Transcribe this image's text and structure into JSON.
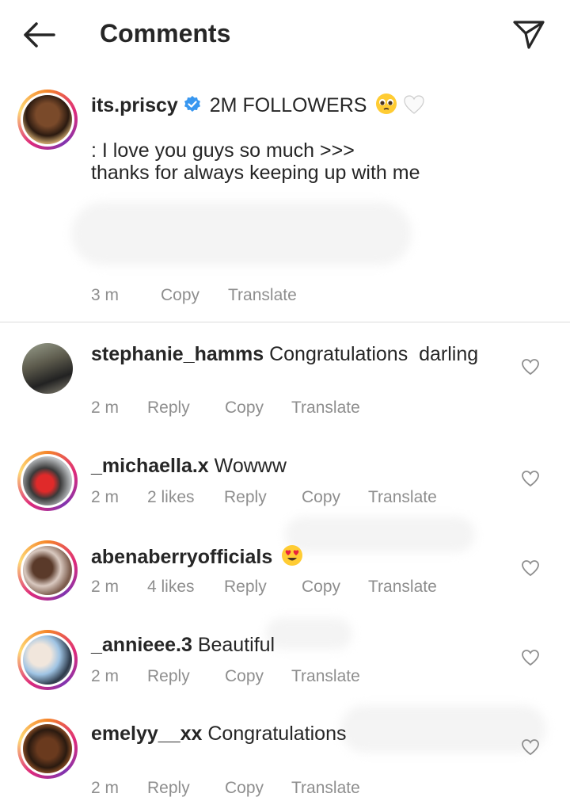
{
  "header": {
    "title": "Comments",
    "back_icon": "arrow-left-icon",
    "share_icon": "paper-plane-icon"
  },
  "caption": {
    "username": "its.priscy",
    "headline": "2M FOLLOWERS",
    "line1": ": I love you guys so much >>>",
    "line2": "thanks for always keeping up with me",
    "time": "3 m",
    "copy": "Copy",
    "translate": "Translate"
  },
  "comments": [
    {
      "username": "stephanie_hamms",
      "text": "Congratulations  darling",
      "time": "2 m",
      "likes": "",
      "reply": "Reply",
      "copy": "Copy",
      "translate": "Translate"
    },
    {
      "username": "_michaella.x",
      "text": "Wowww",
      "time": "2 m",
      "likes": "2 likes",
      "reply": "Reply",
      "copy": "Copy",
      "translate": "Translate"
    },
    {
      "username": "abenaberryofficials",
      "text": "",
      "time": "2 m",
      "likes": "4 likes",
      "reply": "Reply",
      "copy": "Copy",
      "translate": "Translate"
    },
    {
      "username": "_annieee.3",
      "text": "Beautiful",
      "time": "2 m",
      "likes": "",
      "reply": "Reply",
      "copy": "Copy",
      "translate": "Translate"
    },
    {
      "username": "emelyy__xx",
      "text": "Congratulations",
      "time": "2 m",
      "likes": "",
      "reply": "Reply",
      "copy": "Copy",
      "translate": "Translate"
    }
  ],
  "colors": {
    "text": "#262626",
    "meta": "#8e8e8e",
    "verified": "#3897f0",
    "divider": "#dbdbdb"
  }
}
